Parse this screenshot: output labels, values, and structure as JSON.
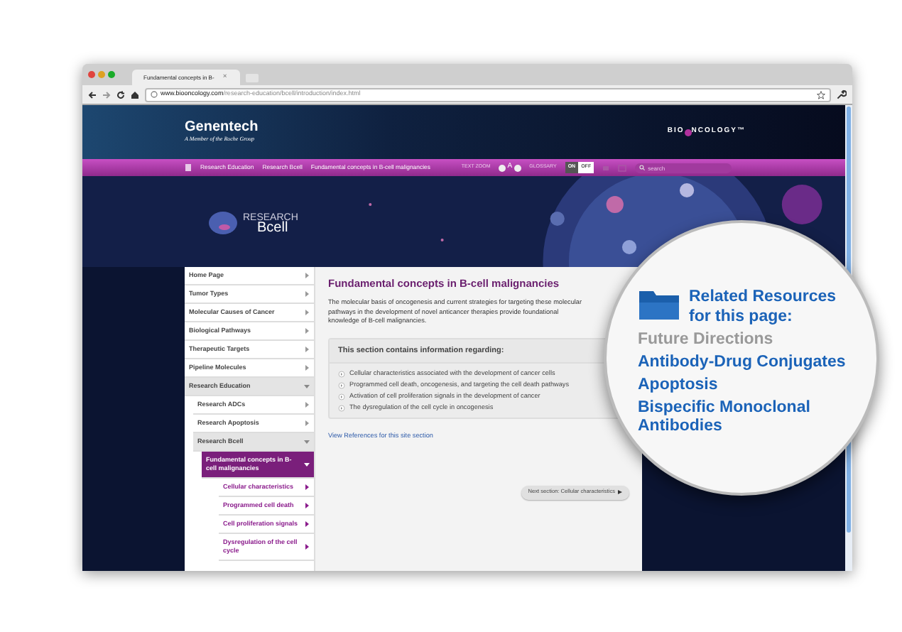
{
  "browser": {
    "tab_title": "Fundamental concepts in B-",
    "tab_close": "×",
    "url_host": "www.biooncology.com",
    "url_path": "/research-education/bcell/introduction/index.html"
  },
  "header": {
    "brand": "Genentech",
    "brand_tagline": "A Member of the Roche Group",
    "site_logo_left": "BIO",
    "site_logo_right": "NCOLOGY™"
  },
  "nav": {
    "breadcrumbs": [
      "Research Education",
      "Research Bcell",
      "Fundamental concepts in B-cell malignancies"
    ],
    "text_zoom_label": "TEXT ZOOM",
    "text_zoom_letter": "A",
    "glossary_label": "GLOSSARY",
    "glossary_options": [
      {
        "label": "ON",
        "selected": false
      },
      {
        "label": "OFF",
        "selected": true
      }
    ],
    "search": {
      "placeholder": "search"
    }
  },
  "hero": {
    "logo_top": "RESEARCH",
    "logo_bottom": "Bcell"
  },
  "sidebar": {
    "items": [
      {
        "label": "Home Page",
        "selected": false,
        "expanded": false
      },
      {
        "label": "Tumor Types",
        "selected": false,
        "expanded": false
      },
      {
        "label": "Molecular Causes of Cancer",
        "selected": false,
        "expanded": false
      },
      {
        "label": "Biological Pathways",
        "selected": false,
        "expanded": false
      },
      {
        "label": "Therapeutic Targets",
        "selected": false,
        "expanded": false
      },
      {
        "label": "Pipeline Molecules",
        "selected": false,
        "expanded": false
      },
      {
        "label": "Research Education",
        "selected": false,
        "expanded": true,
        "children": [
          {
            "label": "Research ADCs",
            "selected": false,
            "expanded": false
          },
          {
            "label": "Research Apoptosis",
            "selected": false,
            "expanded": false
          },
          {
            "label": "Research Bcell",
            "selected": false,
            "expanded": true,
            "children": [
              {
                "label": "Fundamental concepts in B-cell malignancies",
                "selected": true,
                "expanded": true,
                "children": [
                  {
                    "label": "Cellular characteristics",
                    "selected": false,
                    "expanded": false
                  },
                  {
                    "label": "Programmed cell death",
                    "selected": false,
                    "expanded": false
                  },
                  {
                    "label": "Cell proliferation signals",
                    "selected": false,
                    "expanded": false
                  },
                  {
                    "label": "Dysregulation of the cell cycle",
                    "selected": false,
                    "expanded": false
                  }
                ]
              }
            ]
          }
        ]
      }
    ]
  },
  "main": {
    "title": "Fundamental concepts in B-cell malignancies",
    "intro": "The molecular basis of oncogenesis and current strategies for targeting these molecular pathways in the development of novel anticancer therapies provide foundational knowledge of B-cell malignancies.",
    "info_box": {
      "heading": "This section contains information regarding:",
      "items": [
        "Cellular characteristics associated with the development of cancer cells",
        "Programmed cell death, oncogenesis, and targeting the cell death pathways",
        "Activation of cell proliferation signals in the development of cancer",
        "The dysregulation of the cell cycle in oncogenesis"
      ]
    },
    "references_link": "View References for this site section",
    "next_button": "Next section: Cellular characteristics"
  },
  "magnifier": {
    "heading": "Related Resources for this page:",
    "links": [
      {
        "label": "Future Directions",
        "selected": true
      },
      {
        "label": "Antibody-Drug Conjugates",
        "selected": false
      },
      {
        "label": "Apoptosis",
        "selected": false
      },
      {
        "label": "Bispecific Monoclonal Antibodies",
        "selected": false
      }
    ]
  }
}
